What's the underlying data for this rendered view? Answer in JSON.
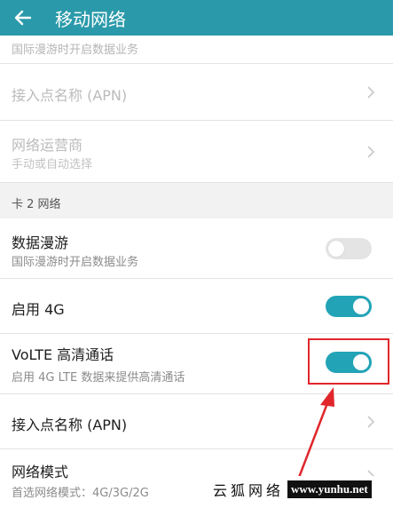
{
  "header": {
    "title": "移动网络"
  },
  "top_partial": {
    "sub": "国际漫游时开启数据业务"
  },
  "card1": {
    "apn_title": "接入点名称 (APN)",
    "operator_title": "网络运营商",
    "operator_sub": "手动或自动选择"
  },
  "section2": {
    "label": "卡 2 网络"
  },
  "card2": {
    "roaming_title": "数据漫游",
    "roaming_sub": "国际漫游时开启数据业务",
    "roaming_state": "off",
    "enable4g_title": "启用 4G",
    "enable4g_state": "on",
    "volte_title": "VoLTE 高清通话",
    "volte_sub": "启用 4G LTE 数据来提供高清通话",
    "volte_state": "on",
    "apn_title": "接入点名称 (APN)",
    "netmode_title": "网络模式",
    "netmode_sub": "首选网络模式：4G/3G/2G"
  },
  "annotation": {
    "highlight_color": "#e0262b"
  },
  "watermark": {
    "left_text": "云狐网络",
    "right_text": "www.yunhu.net"
  },
  "colors": {
    "header_bg": "#2a9aaa",
    "toggle_on": "#23a3b6",
    "toggle_off": "#e4e4e4"
  }
}
